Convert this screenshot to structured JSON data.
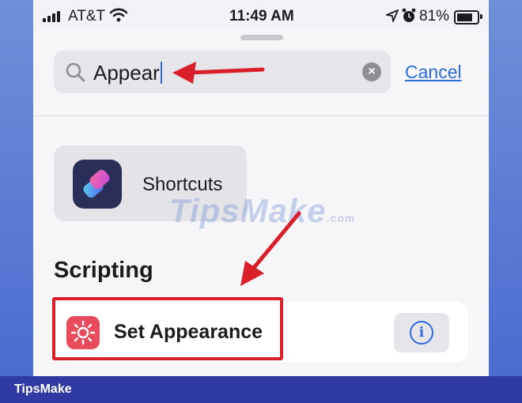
{
  "status_bar": {
    "carrier": "AT&T",
    "time": "11:49 AM",
    "battery_percent": "81%",
    "battery_level": 0.81
  },
  "search": {
    "query": "Appear",
    "cancel_label": "Cancel"
  },
  "apps": [
    {
      "name": "Shortcuts",
      "icon": "shortcuts-app-icon"
    }
  ],
  "section": {
    "title": "Scripting"
  },
  "actions": [
    {
      "label": "Set Appearance",
      "icon": "brightness-icon"
    }
  ],
  "watermark": {
    "text": "TipsMake",
    "suffix": ".com"
  },
  "footer": {
    "brand": "TipsMake"
  },
  "colors": {
    "accent_blue": "#2b6bd6",
    "annotation_red": "#d91f2a",
    "action_icon_bg": "#e84b5c",
    "frame_blue": "#2f3aa3"
  }
}
